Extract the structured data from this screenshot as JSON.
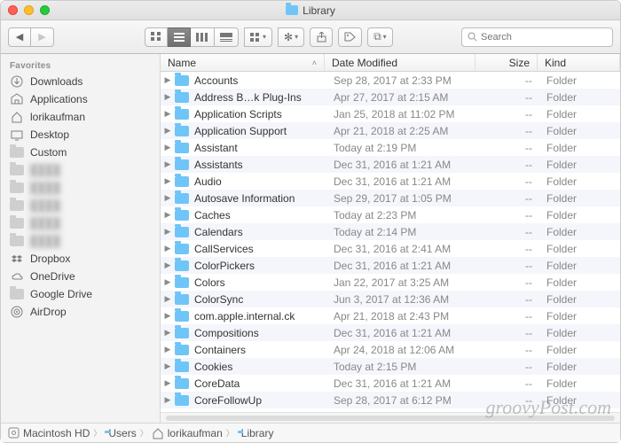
{
  "window_title": "Library",
  "search": {
    "placeholder": "Search"
  },
  "sidebar": {
    "section": "Favorites",
    "items": [
      {
        "label": "Downloads",
        "icon": "download-icon"
      },
      {
        "label": "Applications",
        "icon": "apps-icon"
      },
      {
        "label": "lorikaufman",
        "icon": "home-icon"
      },
      {
        "label": "Desktop",
        "icon": "desktop-icon"
      },
      {
        "label": "Custom",
        "icon": "folder-icon"
      },
      {
        "label": "",
        "icon": "folder-icon",
        "blur": true
      },
      {
        "label": "",
        "icon": "folder-icon",
        "blur": true
      },
      {
        "label": "",
        "icon": "folder-icon",
        "blur": true
      },
      {
        "label": "",
        "icon": "folder-icon",
        "blur": true
      },
      {
        "label": "",
        "icon": "folder-icon",
        "blur": true
      },
      {
        "label": "Dropbox",
        "icon": "dropbox-icon"
      },
      {
        "label": "OneDrive",
        "icon": "onedrive-icon"
      },
      {
        "label": "Google Drive",
        "icon": "folder-icon"
      },
      {
        "label": "AirDrop",
        "icon": "airdrop-icon"
      }
    ]
  },
  "columns": {
    "name": "Name",
    "date": "Date Modified",
    "size": "Size",
    "kind": "Kind"
  },
  "rows": [
    {
      "name": "Accounts",
      "date": "Sep 28, 2017 at 2:33 PM",
      "size": "--",
      "kind": "Folder"
    },
    {
      "name": "Address B…k Plug-Ins",
      "date": "Apr 27, 2017 at 2:15 AM",
      "size": "--",
      "kind": "Folder"
    },
    {
      "name": "Application Scripts",
      "date": "Jan 25, 2018 at 11:02 PM",
      "size": "--",
      "kind": "Folder"
    },
    {
      "name": "Application Support",
      "date": "Apr 21, 2018 at 2:25 AM",
      "size": "--",
      "kind": "Folder"
    },
    {
      "name": "Assistant",
      "date": "Today at 2:19 PM",
      "size": "--",
      "kind": "Folder"
    },
    {
      "name": "Assistants",
      "date": "Dec 31, 2016 at 1:21 AM",
      "size": "--",
      "kind": "Folder"
    },
    {
      "name": "Audio",
      "date": "Dec 31, 2016 at 1:21 AM",
      "size": "--",
      "kind": "Folder"
    },
    {
      "name": "Autosave Information",
      "date": "Sep 29, 2017 at 1:05 PM",
      "size": "--",
      "kind": "Folder"
    },
    {
      "name": "Caches",
      "date": "Today at 2:23 PM",
      "size": "--",
      "kind": "Folder"
    },
    {
      "name": "Calendars",
      "date": "Today at 2:14 PM",
      "size": "--",
      "kind": "Folder"
    },
    {
      "name": "CallServices",
      "date": "Dec 31, 2016 at 2:41 AM",
      "size": "--",
      "kind": "Folder"
    },
    {
      "name": "ColorPickers",
      "date": "Dec 31, 2016 at 1:21 AM",
      "size": "--",
      "kind": "Folder"
    },
    {
      "name": "Colors",
      "date": "Jan 22, 2017 at 3:25 AM",
      "size": "--",
      "kind": "Folder"
    },
    {
      "name": "ColorSync",
      "date": "Jun 3, 2017 at 12:36 AM",
      "size": "--",
      "kind": "Folder"
    },
    {
      "name": "com.apple.internal.ck",
      "date": "Apr 21, 2018 at 2:43 PM",
      "size": "--",
      "kind": "Folder"
    },
    {
      "name": "Compositions",
      "date": "Dec 31, 2016 at 1:21 AM",
      "size": "--",
      "kind": "Folder"
    },
    {
      "name": "Containers",
      "date": "Apr 24, 2018 at 12:06 AM",
      "size": "--",
      "kind": "Folder"
    },
    {
      "name": "Cookies",
      "date": "Today at 2:15 PM",
      "size": "--",
      "kind": "Folder"
    },
    {
      "name": "CoreData",
      "date": "Dec 31, 2016 at 1:21 AM",
      "size": "--",
      "kind": "Folder"
    },
    {
      "name": "CoreFollowUp",
      "date": "Sep 28, 2017 at 6:12 PM",
      "size": "--",
      "kind": "Folder"
    }
  ],
  "path": [
    {
      "label": "Macintosh HD",
      "icon": "disk-icon"
    },
    {
      "label": "Users",
      "icon": "folder-icon"
    },
    {
      "label": "lorikaufman",
      "icon": "home-icon"
    },
    {
      "label": "Library",
      "icon": "folder-icon"
    }
  ],
  "watermark": "groovyPost.com"
}
